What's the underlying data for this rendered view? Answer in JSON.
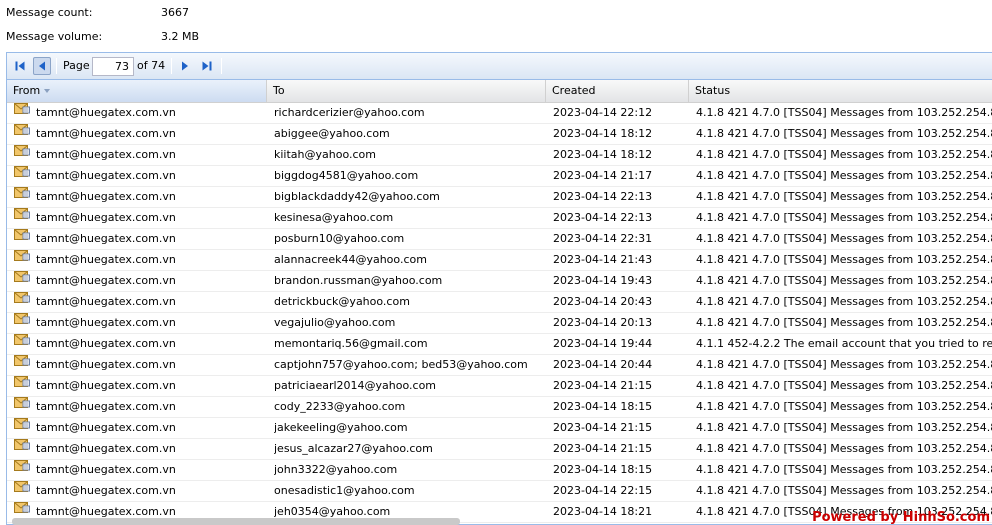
{
  "summary": {
    "message_count_label": "Message count:",
    "message_count": "3667",
    "message_volume_label": "Message volume:",
    "message_volume": "3.2 MB"
  },
  "paging": {
    "page_label": "Page",
    "current_page": "73",
    "of_total": "of 74"
  },
  "columns": {
    "from": "From",
    "to": "To",
    "created": "Created",
    "status": "Status"
  },
  "rows": [
    {
      "from": "tamnt@huegatex.com.vn",
      "to": "richardcerizier@yahoo.com",
      "created": "2023-04-14 22:12",
      "status": "4.1.8 421 4.7.0 [TSS04] Messages from 103.252.254.8"
    },
    {
      "from": "tamnt@huegatex.com.vn",
      "to": "abiggee@yahoo.com",
      "created": "2023-04-14 18:12",
      "status": "4.1.8 421 4.7.0 [TSS04] Messages from 103.252.254.8"
    },
    {
      "from": "tamnt@huegatex.com.vn",
      "to": "kiitah@yahoo.com",
      "created": "2023-04-14 18:12",
      "status": "4.1.8 421 4.7.0 [TSS04] Messages from 103.252.254.8"
    },
    {
      "from": "tamnt@huegatex.com.vn",
      "to": "biggdog4581@yahoo.com",
      "created": "2023-04-14 21:17",
      "status": "4.1.8 421 4.7.0 [TSS04] Messages from 103.252.254.8"
    },
    {
      "from": "tamnt@huegatex.com.vn",
      "to": "bigblackdaddy42@yahoo.com",
      "created": "2023-04-14 22:13",
      "status": "4.1.8 421 4.7.0 [TSS04] Messages from 103.252.254.8"
    },
    {
      "from": "tamnt@huegatex.com.vn",
      "to": "kesinesa@yahoo.com",
      "created": "2023-04-14 22:13",
      "status": "4.1.8 421 4.7.0 [TSS04] Messages from 103.252.254.8"
    },
    {
      "from": "tamnt@huegatex.com.vn",
      "to": "posburn10@yahoo.com",
      "created": "2023-04-14 22:31",
      "status": "4.1.8 421 4.7.0 [TSS04] Messages from 103.252.254.8"
    },
    {
      "from": "tamnt@huegatex.com.vn",
      "to": "alannacreek44@yahoo.com",
      "created": "2023-04-14 21:43",
      "status": "4.1.8 421 4.7.0 [TSS04] Messages from 103.252.254.8"
    },
    {
      "from": "tamnt@huegatex.com.vn",
      "to": "brandon.russman@yahoo.com",
      "created": "2023-04-14 19:43",
      "status": "4.1.8 421 4.7.0 [TSS04] Messages from 103.252.254.8"
    },
    {
      "from": "tamnt@huegatex.com.vn",
      "to": "detrickbuck@yahoo.com",
      "created": "2023-04-14 20:43",
      "status": "4.1.8 421 4.7.0 [TSS04] Messages from 103.252.254.8"
    },
    {
      "from": "tamnt@huegatex.com.vn",
      "to": "vegajulio@yahoo.com",
      "created": "2023-04-14 20:13",
      "status": "4.1.8 421 4.7.0 [TSS04] Messages from 103.252.254.8"
    },
    {
      "from": "tamnt@huegatex.com.vn",
      "to": "memontariq.56@gmail.com",
      "created": "2023-04-14 19:44",
      "status": "4.1.1 452-4.2.2 The email account that you tried to re"
    },
    {
      "from": "tamnt@huegatex.com.vn",
      "to": "captjohn757@yahoo.com; bed53@yahoo.com",
      "created": "2023-04-14 20:44",
      "status": "4.1.8 421 4.7.0 [TSS04] Messages from 103.252.254.8"
    },
    {
      "from": "tamnt@huegatex.com.vn",
      "to": "patriciaearl2014@yahoo.com",
      "created": "2023-04-14 21:15",
      "status": "4.1.8 421 4.7.0 [TSS04] Messages from 103.252.254.8"
    },
    {
      "from": "tamnt@huegatex.com.vn",
      "to": "cody_2233@yahoo.com",
      "created": "2023-04-14 18:15",
      "status": "4.1.8 421 4.7.0 [TSS04] Messages from 103.252.254.8"
    },
    {
      "from": "tamnt@huegatex.com.vn",
      "to": "jakekeeling@yahoo.com",
      "created": "2023-04-14 21:15",
      "status": "4.1.8 421 4.7.0 [TSS04] Messages from 103.252.254.8"
    },
    {
      "from": "tamnt@huegatex.com.vn",
      "to": "jesus_alcazar27@yahoo.com",
      "created": "2023-04-14 21:15",
      "status": "4.1.8 421 4.7.0 [TSS04] Messages from 103.252.254.8"
    },
    {
      "from": "tamnt@huegatex.com.vn",
      "to": "john3322@yahoo.com",
      "created": "2023-04-14 18:15",
      "status": "4.1.8 421 4.7.0 [TSS04] Messages from 103.252.254.8"
    },
    {
      "from": "tamnt@huegatex.com.vn",
      "to": "onesadistic1@yahoo.com",
      "created": "2023-04-14 22:15",
      "status": "4.1.8 421 4.7.0 [TSS04] Messages from 103.252.254.8"
    },
    {
      "from": "tamnt@huegatex.com.vn",
      "to": "jeh0354@yahoo.com",
      "created": "2023-04-14 18:21",
      "status": "4.1.8 421 4.7.0 [TSS04] Messages from 103.252.254.8"
    }
  ],
  "icons": {
    "first": "first-page-icon",
    "prev": "previous-page-icon",
    "next": "next-page-icon",
    "last": "last-page-icon",
    "message": "envelope-icon",
    "sort": "sort-descending-icon"
  },
  "colors": {
    "toolbar_border": "#99bbe8",
    "nav_icon": "#1e62c8",
    "watermark": "#cc0000"
  },
  "watermark": "Powered by HinhSo.com"
}
